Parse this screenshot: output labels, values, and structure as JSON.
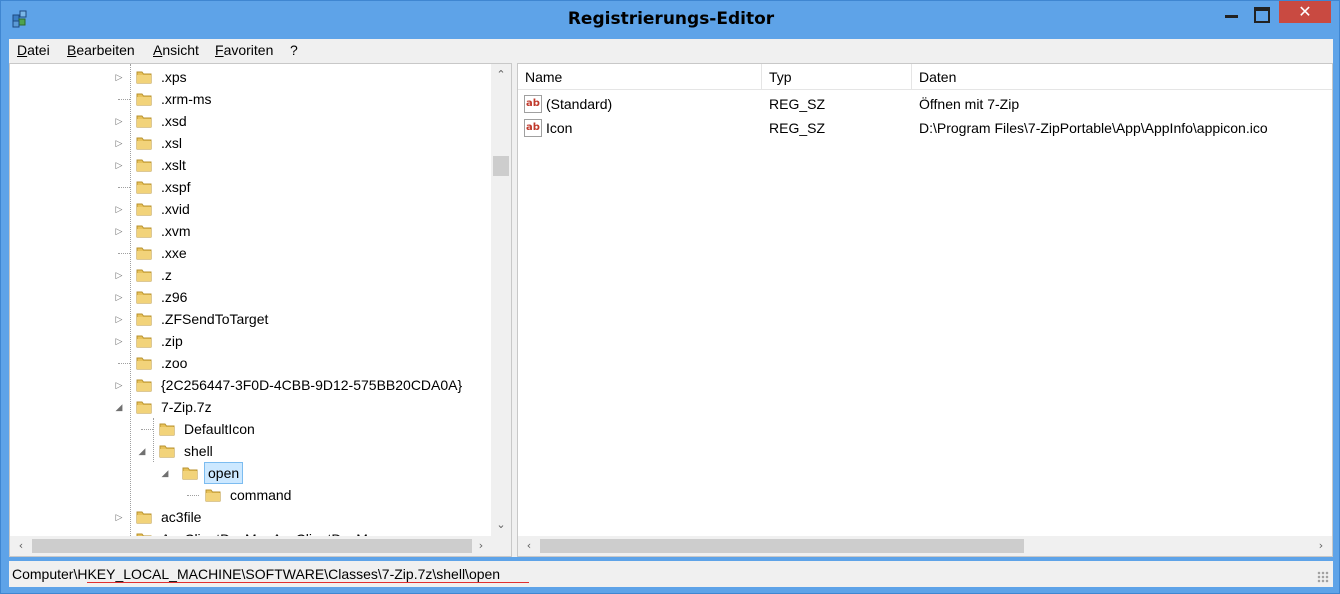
{
  "window": {
    "title": "Registrierungs-Editor",
    "close_glyph": "✕"
  },
  "menu": [
    "Datei",
    "Bearbeiten",
    "Ansicht",
    "Favoriten",
    "?"
  ],
  "tree": {
    "nodes": [
      {
        "label": ".xps",
        "expandable": true,
        "selected": false
      },
      {
        "label": ".xrm-ms",
        "expandable": false,
        "selected": false
      },
      {
        "label": ".xsd",
        "expandable": true,
        "selected": false
      },
      {
        "label": ".xsl",
        "expandable": true,
        "selected": false
      },
      {
        "label": ".xslt",
        "expandable": true,
        "selected": false
      },
      {
        "label": ".xspf",
        "expandable": false,
        "selected": false
      },
      {
        "label": ".xvid",
        "expandable": true,
        "selected": false
      },
      {
        "label": ".xvm",
        "expandable": true,
        "selected": false
      },
      {
        "label": ".xxe",
        "expandable": false,
        "selected": false
      },
      {
        "label": ".z",
        "expandable": true,
        "selected": false
      },
      {
        "label": ".z96",
        "expandable": true,
        "selected": false
      },
      {
        "label": ".ZFSendToTarget",
        "expandable": true,
        "selected": false
      },
      {
        "label": ".zip",
        "expandable": true,
        "selected": false
      },
      {
        "label": ".zoo",
        "expandable": false,
        "selected": false
      },
      {
        "label": "{2C256447-3F0D-4CBB-9D12-575BB20CDA0A}",
        "expandable": true,
        "selected": false
      },
      {
        "label": "7-Zip.7z",
        "expandable": true,
        "expanded": true,
        "selected": false
      },
      {
        "label": "DefaultIcon",
        "expandable": false,
        "selected": false
      },
      {
        "label": "shell",
        "expandable": true,
        "expanded": true,
        "selected": false
      },
      {
        "label": "open",
        "expandable": true,
        "expanded": true,
        "selected": true
      },
      {
        "label": "command",
        "expandable": false,
        "selected": false
      },
      {
        "label": "ac3file",
        "expandable": true,
        "selected": false
      },
      {
        "label": "AccClientDocMgr.AccClientDocM...",
        "expandable": true,
        "selected": false
      }
    ]
  },
  "list": {
    "columns": [
      "Name",
      "Typ",
      "Daten"
    ],
    "rows": [
      {
        "icon": "ab",
        "name": "(Standard)",
        "type": "REG_SZ",
        "data": "Öffnen mit 7-Zip"
      },
      {
        "icon": "ab",
        "name": "Icon",
        "type": "REG_SZ",
        "data": "D:\\Program Files\\7-ZipPortable\\App\\AppInfo\\appicon.ico"
      }
    ]
  },
  "status": {
    "path": "Computer\\HKEY_LOCAL_MACHINE\\SOFTWARE\\Classes\\7-Zip.7z\\shell\\open"
  },
  "icons": {
    "app": "registry-editor-icon",
    "folder": "folder-icon",
    "value": "string-value-icon",
    "folder_color": "#e8c25a"
  },
  "scroll": {
    "up": "⌃",
    "down": "⌄",
    "left": "‹",
    "right": "›"
  }
}
